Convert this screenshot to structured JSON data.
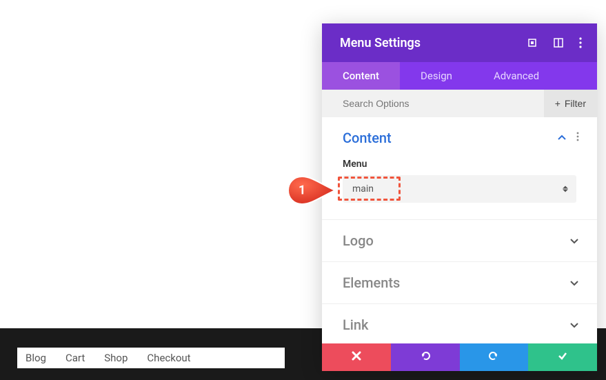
{
  "panel": {
    "title": "Menu Settings",
    "tabs": {
      "content": "Content",
      "design": "Design",
      "advanced": "Advanced"
    },
    "search_placeholder": "Search Options",
    "filter_label": "Filter"
  },
  "sections": {
    "content": {
      "title": "Content",
      "menu_label": "Menu",
      "menu_value": "main"
    },
    "logo": {
      "title": "Logo"
    },
    "elements": {
      "title": "Elements"
    },
    "link": {
      "title": "Link"
    }
  },
  "footer_nav": {
    "blog": "Blog",
    "cart": "Cart",
    "shop": "Shop",
    "checkout": "Checkout"
  },
  "callout": {
    "number": "1"
  }
}
